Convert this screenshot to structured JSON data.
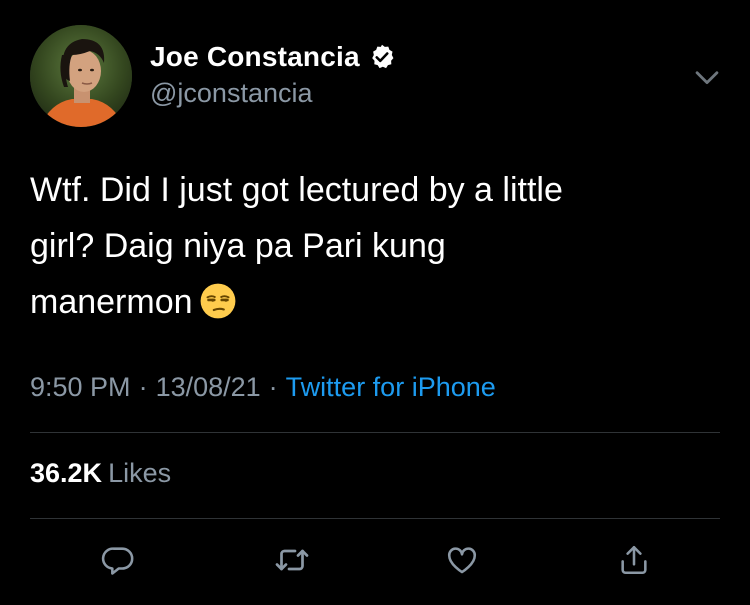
{
  "author": {
    "display_name": "Joe Constancia",
    "handle": "@jconstancia",
    "verified": true
  },
  "tweet": {
    "lines": [
      "Wtf. Did I just got lectured by a little",
      "girl? Daig niya pa Pari kung",
      "manermon"
    ],
    "emoji": "unamused-face"
  },
  "meta": {
    "time": "9:50 PM",
    "separator": "·",
    "date": "13/08/21",
    "source": "Twitter for iPhone"
  },
  "stats": {
    "likes_count": "36.2K",
    "likes_label": "Likes"
  },
  "icons": {
    "reply": "reply-icon",
    "retweet": "retweet-icon",
    "like": "heart-icon",
    "share": "share-icon",
    "more": "chevron-down-icon",
    "verified": "verified-badge-icon"
  },
  "colors": {
    "background": "#000000",
    "primary_text": "#ffffff",
    "secondary_text": "#8b98a5",
    "accent": "#1d9bf0",
    "divider": "#2f3336"
  }
}
